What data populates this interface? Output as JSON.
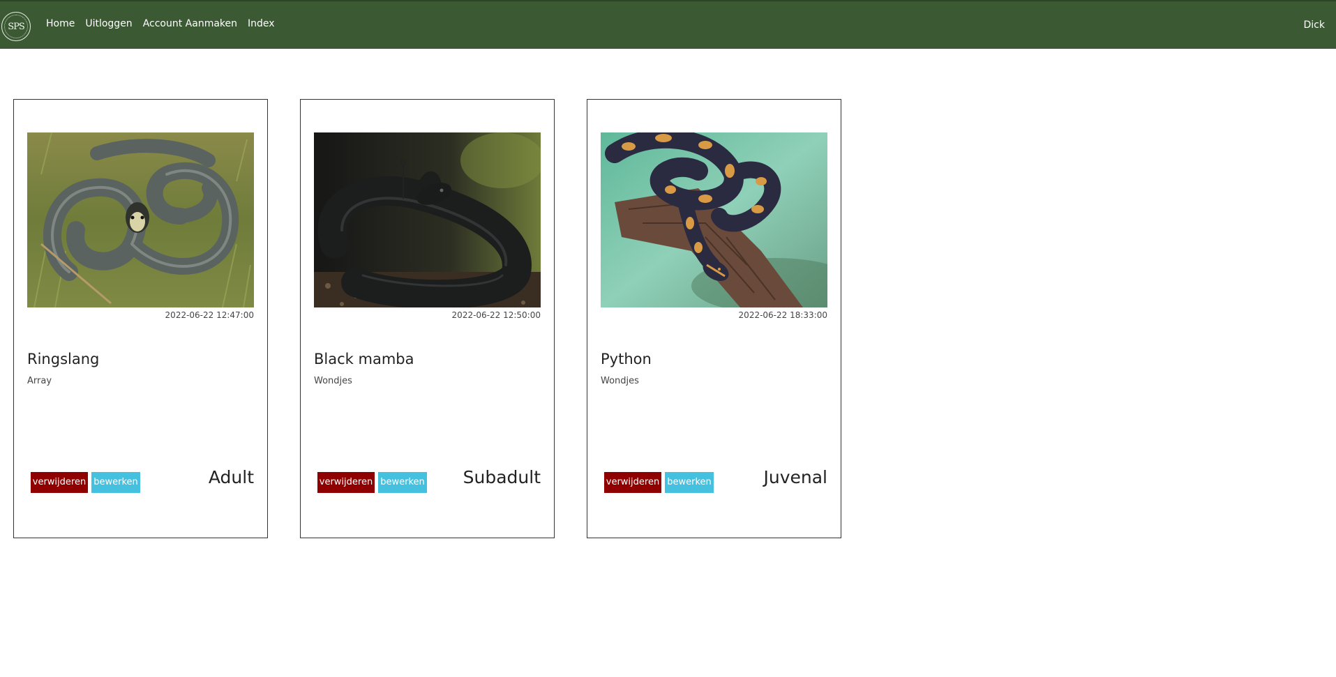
{
  "navbar": {
    "logo_text": "SPS",
    "links": [
      {
        "label": "Home"
      },
      {
        "label": "Uitloggen"
      },
      {
        "label": "Account Aanmaken"
      },
      {
        "label": "Index"
      }
    ],
    "user": "Dick",
    "background": "#3b5a34"
  },
  "buttons": {
    "delete_label": "verwijderen",
    "edit_label": "bewerken",
    "delete_color": "#8f0000",
    "edit_color": "#45c0df"
  },
  "cards": [
    {
      "image_subject": "grass snake photo",
      "date": "2022-06-22 12:47:00",
      "title": "Ringslang",
      "subtitle": "Array",
      "stage": "Adult"
    },
    {
      "image_subject": "black mamba photo",
      "date": "2022-06-22 12:50:00",
      "title": "Black mamba",
      "subtitle": "Wondjes",
      "stage": "Subadult"
    },
    {
      "image_subject": "ball python photo",
      "date": "2022-06-22 18:33:00",
      "title": "Python",
      "subtitle": "Wondjes",
      "stage": "Juvenal"
    }
  ]
}
